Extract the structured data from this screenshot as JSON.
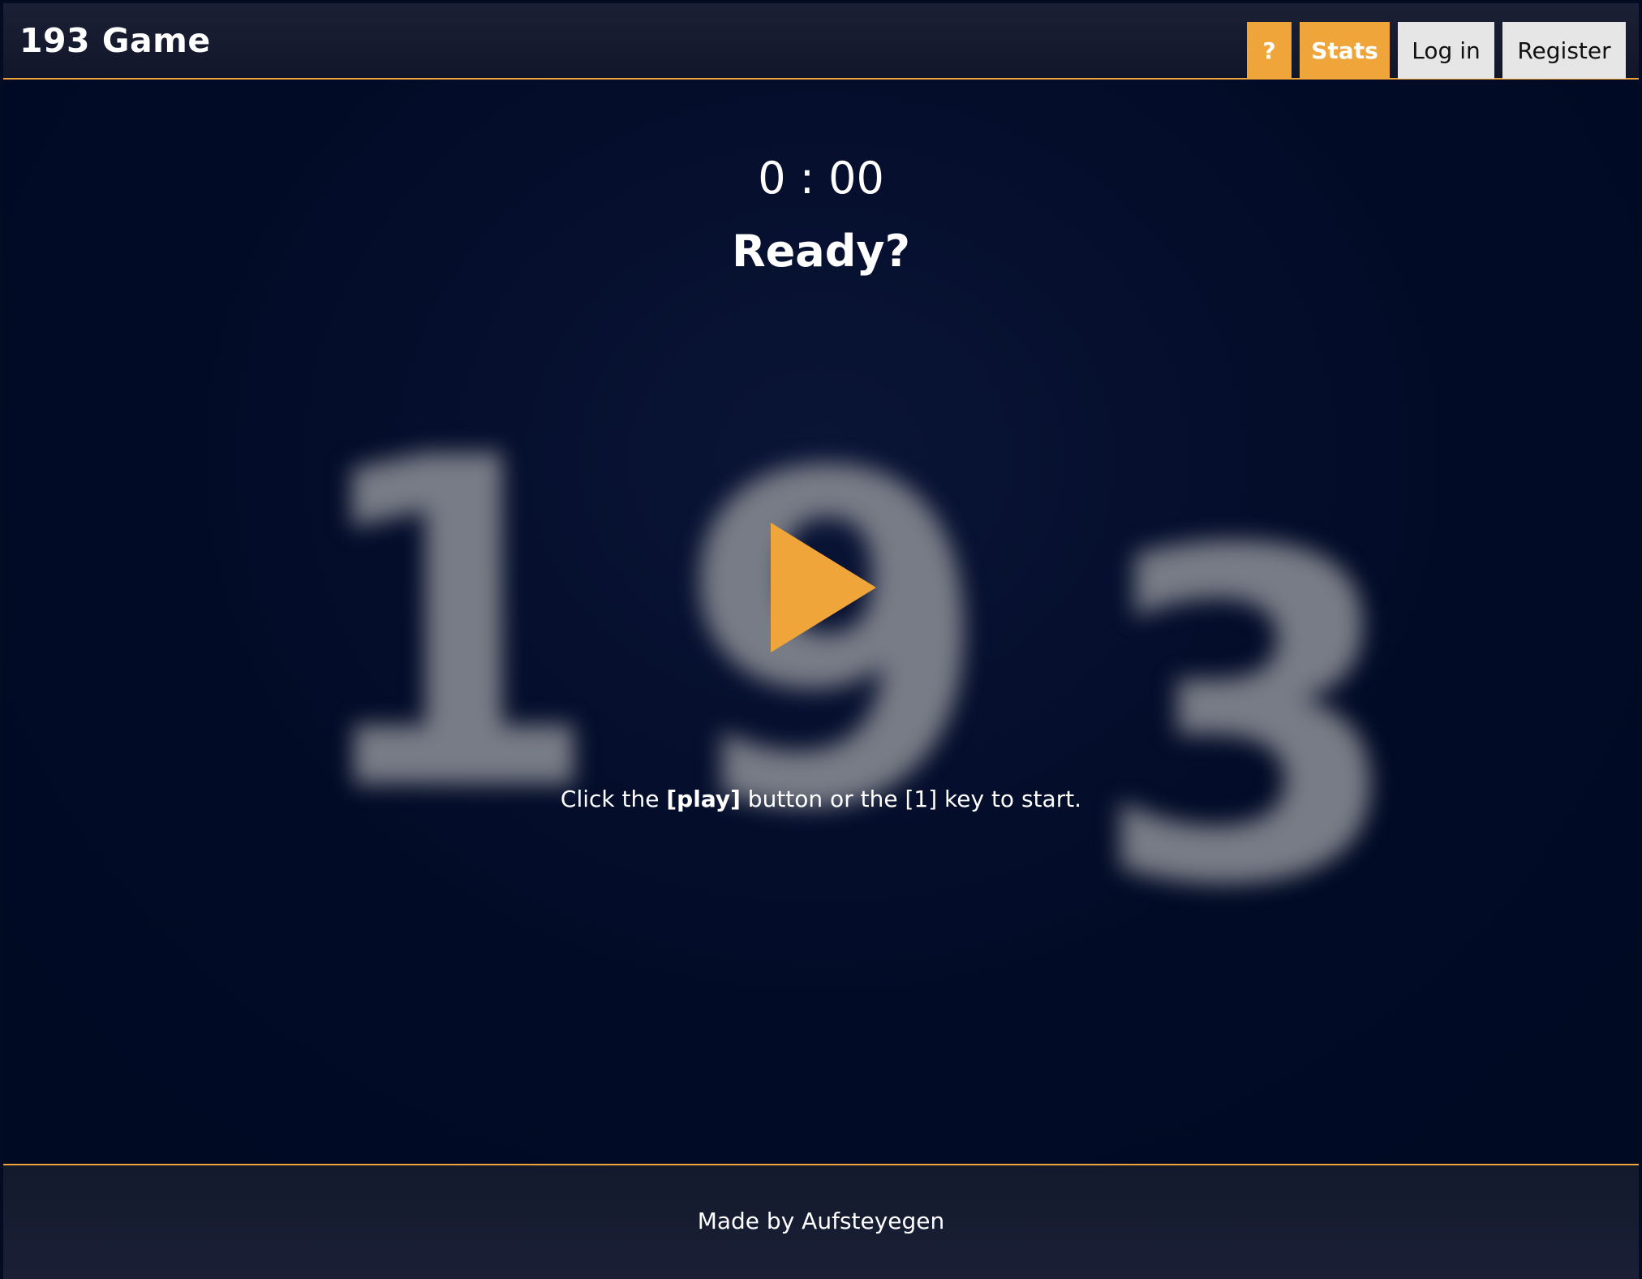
{
  "header": {
    "logo": "193 Game",
    "buttons": {
      "help": "?",
      "stats": "Stats",
      "login": "Log in",
      "register": "Register"
    }
  },
  "game": {
    "timer": "0 : 00",
    "status": "Ready?",
    "background_digits": [
      "1",
      "9",
      "3"
    ],
    "hint": {
      "part1": "Click the ",
      "play_key": "[play]",
      "part2": " button or the ",
      "one_key": "[1]",
      "part3": " key to start."
    },
    "play_icon": "play-icon"
  },
  "footer": {
    "credit": "Made by Aufsteyegen"
  },
  "colors": {
    "accent": "#f0a53a",
    "background": "#000a22",
    "header_bg": "#1c2036",
    "light_button": "#e6e6e6"
  }
}
